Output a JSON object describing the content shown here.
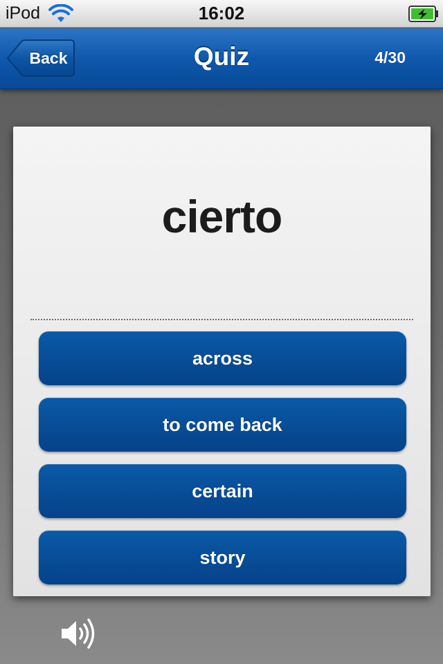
{
  "status_bar": {
    "carrier": "iPod",
    "time": "16:02",
    "icons": [
      "wifi-icon",
      "battery-icon"
    ]
  },
  "nav": {
    "back_label": "Back",
    "title": "Quiz",
    "progress": "4/30"
  },
  "quiz": {
    "word": "cierto",
    "answers": [
      "across",
      "to come back",
      "certain",
      "story"
    ]
  },
  "speaker": {
    "icon": "speaker-icon"
  },
  "colors": {
    "nav_blue": "#0f58ac",
    "button_blue": "#074c96",
    "battery_green": "#3fbf2e"
  }
}
